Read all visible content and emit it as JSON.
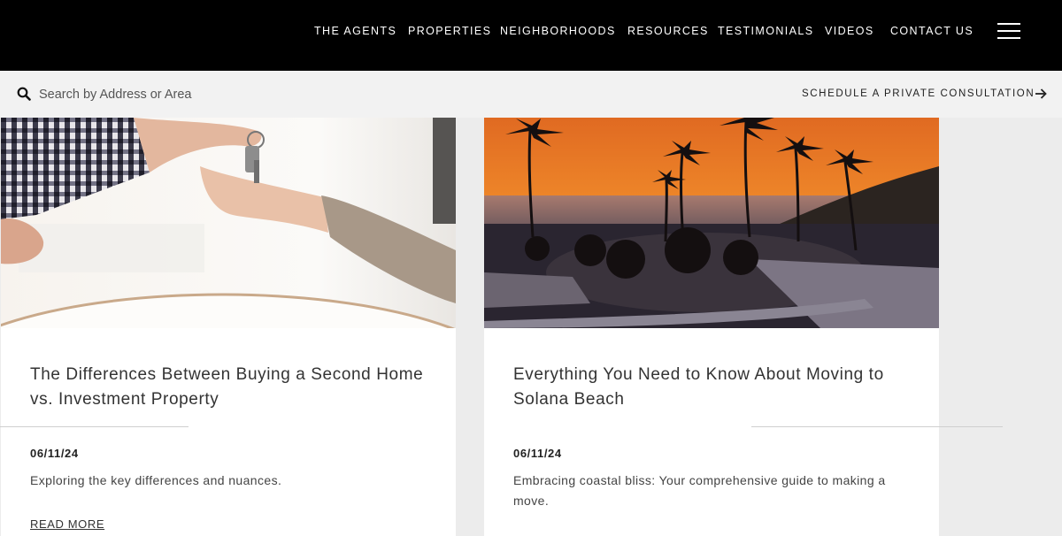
{
  "nav": {
    "items": [
      {
        "label": "THE AGENTS"
      },
      {
        "label": "PROPERTIES"
      },
      {
        "label": "NEIGHBORHOODS"
      },
      {
        "label": "RESOURCES"
      },
      {
        "label": "TESTIMONIALS"
      },
      {
        "label": "VIDEOS"
      },
      {
        "label": "CONTACT US"
      }
    ],
    "menu_icon": "hamburger-menu-icon"
  },
  "search": {
    "placeholder": "Search by Address or Area",
    "value": "",
    "icon": "search-icon"
  },
  "consultation": {
    "label": "SCHEDULE A PRIVATE CONSULTATION",
    "icon": "arrow-right-icon"
  },
  "posts": [
    {
      "image": "hand-passing-house-keys-photo",
      "title": "The Differences Between Buying a Second Home vs. Investment Property",
      "date": "06/11/24",
      "excerpt": "Exploring the key differences and nuances.",
      "link_label": "READ MORE"
    },
    {
      "image": "solana-beach-sunset-palm-trees-photo",
      "title": "Everything You Need to Know About Moving to Solana Beach",
      "date": "06/11/24",
      "excerpt": "Embracing coastal bliss: Your comprehensive guide to making a move.",
      "link_label": ""
    }
  ],
  "colors": {
    "nav_background": "#000000",
    "search_background": "#f2f2f2",
    "page_background": "#ececec",
    "card_background": "#ffffff",
    "text": "#333333"
  }
}
